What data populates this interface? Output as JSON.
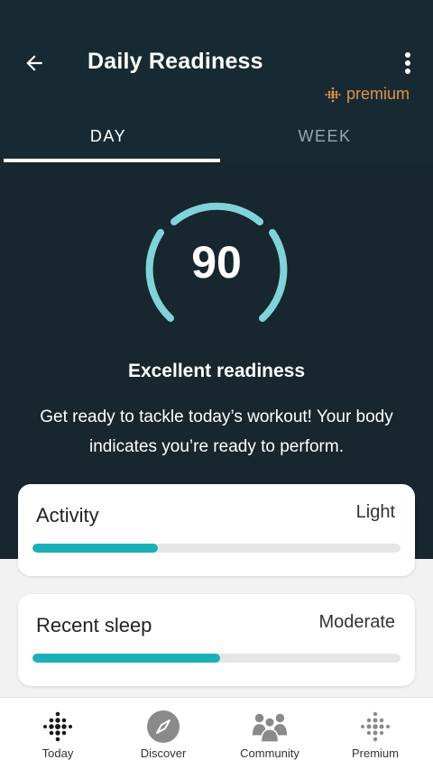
{
  "header": {
    "title": "Daily Readiness",
    "premium_label": "premium"
  },
  "tabs": [
    {
      "label": "DAY",
      "selected": true
    },
    {
      "label": "WEEK",
      "selected": false
    }
  ],
  "score": {
    "value": "90",
    "title": "Excellent readiness",
    "description": "Get ready to tackle today’s workout! Your body indicates you’re ready to perform."
  },
  "cards": [
    {
      "title": "Activity",
      "value": "Light",
      "progress": 0.34
    },
    {
      "title": "Recent sleep",
      "value": "Moderate",
      "progress": 0.51
    }
  ],
  "bottom_nav": [
    {
      "label": "Today",
      "icon": "fitbit-dots-icon"
    },
    {
      "label": "Discover",
      "icon": "compass-icon"
    },
    {
      "label": "Community",
      "icon": "community-icon"
    },
    {
      "label": "Premium",
      "icon": "premium-dots-icon"
    }
  ],
  "colors": {
    "background_dark": "#17262f",
    "accent_teal": "#1ab0b8",
    "ring": "#7fd3d9",
    "premium": "#e0924a"
  }
}
